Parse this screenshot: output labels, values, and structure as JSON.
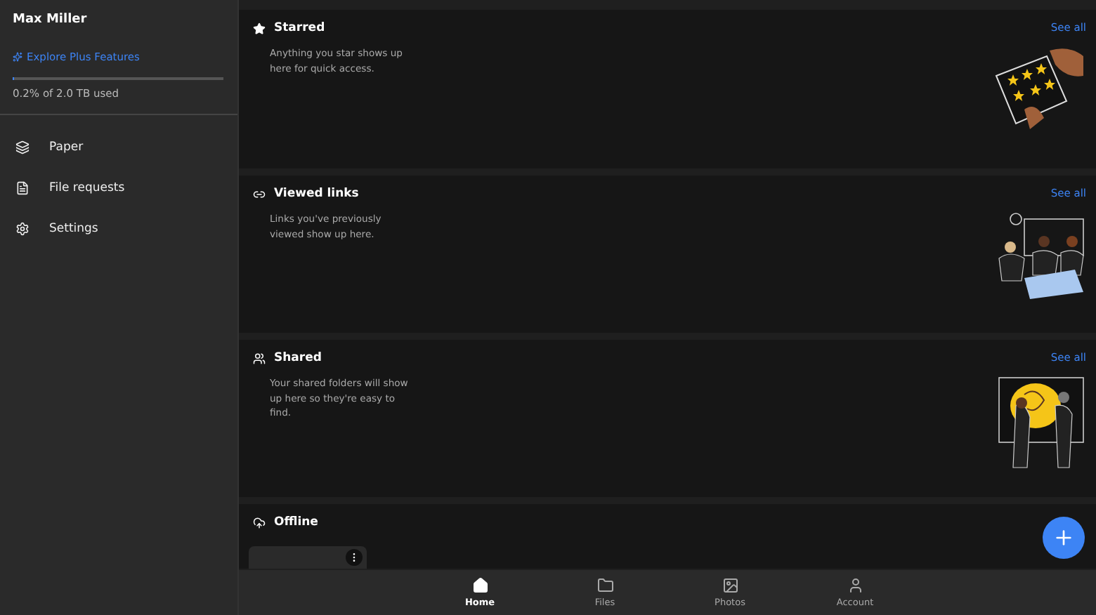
{
  "sidebar": {
    "user_name": "Max Miller",
    "upgrade_link": "Explore Plus Features",
    "storage": {
      "level": 0.002,
      "reading": "0.2% of 2.0 TB used"
    },
    "items": [
      {
        "kind": "paper",
        "label": "Paper"
      },
      {
        "kind": "file-requests",
        "label": "File requests"
      },
      {
        "kind": "settings",
        "label": "Settings"
      }
    ]
  },
  "sections": [
    {
      "kind": "starred",
      "title": "Starred",
      "description": "Anything you star shows up here for quick access.",
      "action": "See all"
    },
    {
      "kind": "links",
      "title": "Viewed links",
      "description": "Links you've previously viewed show up here.",
      "action": "See all"
    },
    {
      "kind": "shared",
      "title": "Shared",
      "description": "Your shared folders will show up here so they're easy to find.",
      "action": "See all"
    },
    {
      "kind": "offline",
      "title": "Offline"
    }
  ],
  "bottom_nav": [
    {
      "kind": "home",
      "label": "Home",
      "selected": true
    },
    {
      "kind": "files",
      "label": "Files",
      "selected": false
    },
    {
      "kind": "photos",
      "label": "Photos",
      "selected": false
    },
    {
      "kind": "account",
      "label": "Account",
      "selected": false
    }
  ]
}
